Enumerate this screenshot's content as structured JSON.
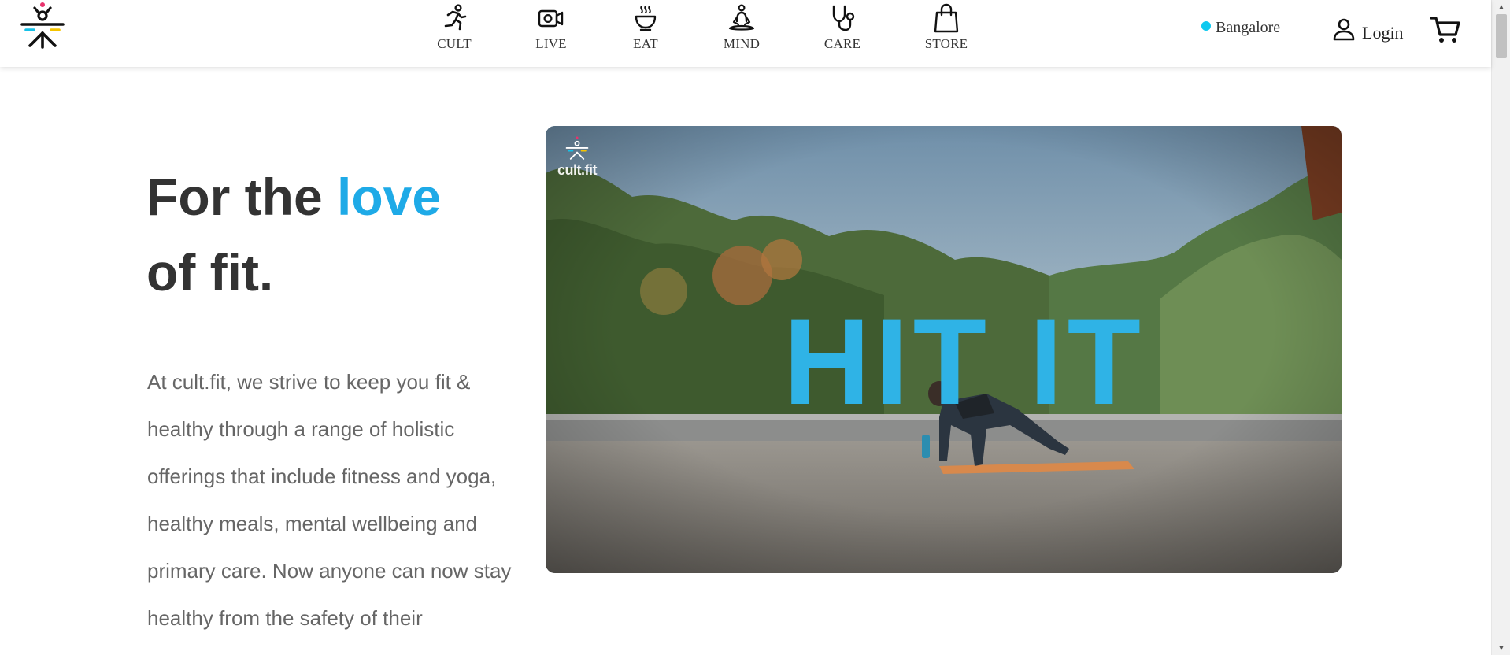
{
  "header": {
    "logo_alt": "cult.fit",
    "nav": [
      {
        "label": "CULT",
        "icon": "runner-icon"
      },
      {
        "label": "LIVE",
        "icon": "video-camera-icon"
      },
      {
        "label": "EAT",
        "icon": "bowl-icon"
      },
      {
        "label": "MIND",
        "icon": "meditation-icon"
      },
      {
        "label": "CARE",
        "icon": "stethoscope-icon"
      },
      {
        "label": "STORE",
        "icon": "shopping-bag-icon"
      }
    ],
    "city": "Bangalore",
    "login": "Login",
    "cart_icon": "cart-icon"
  },
  "hero": {
    "title_part1": "For the",
    "title_accent": "love",
    "title_part2": "of fit.",
    "description": "At cult.fit, we strive to keep you fit & healthy through a range of holistic offerings that include fitness and yoga, healthy meals, mental wellbeing and primary care. Now anyone can now stay healthy from the safety of their"
  },
  "video": {
    "brand": "cult.fit",
    "headline": "HIT IT"
  },
  "colors": {
    "accent": "#1eaae7",
    "city_dot": "#0fc9ef",
    "title": "#333333",
    "body_text": "#666666"
  }
}
